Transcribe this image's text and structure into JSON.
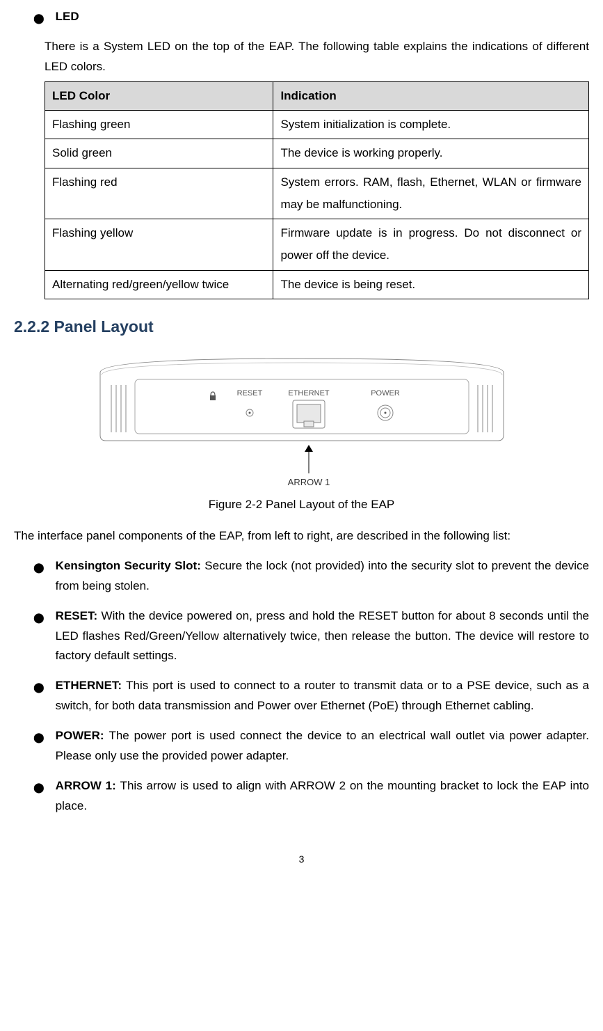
{
  "led": {
    "heading": "LED",
    "intro": "There is a System LED on the top of the EAP. The following table explains the indications of different LED colors.",
    "table": {
      "headers": {
        "col1": "LED Color",
        "col2": "Indication"
      },
      "rows": [
        {
          "color": "Flashing green",
          "indication": "System initialization is complete."
        },
        {
          "color": "Solid green",
          "indication": "The device is working properly."
        },
        {
          "color": "Flashing red",
          "indication": "System errors. RAM, flash, Ethernet, WLAN or firmware may be malfunctioning."
        },
        {
          "color": "Flashing yellow",
          "indication": "Firmware update is in progress. Do not disconnect or power off the device."
        },
        {
          "color": "Alternating red/green/yellow twice",
          "indication": "The device is being reset."
        }
      ]
    }
  },
  "section": {
    "number": "2.2.2",
    "title": "Panel Layout"
  },
  "figure": {
    "labels": {
      "reset": "RESET",
      "ethernet": "ETHERNET",
      "power": "POWER",
      "arrow": "ARROW 1"
    },
    "caption": "Figure 2-2 Panel Layout of the EAP"
  },
  "interface": {
    "intro": "The interface panel components of the EAP, from left to right, are described in the following list:",
    "items": [
      {
        "title": "Kensington Security Slot: ",
        "desc": "Secure the lock (not provided) into the security slot to prevent the device from being stolen."
      },
      {
        "title": "RESET: ",
        "desc": "With the device powered on, press and hold the RESET button for about 8 seconds until the LED flashes Red/Green/Yellow alternatively twice, then release the button. The device will restore to factory default settings."
      },
      {
        "title": "ETHERNET: ",
        "desc": "This port is used to connect to a router to transmit data or to a PSE device, such as a switch, for both data transmission and Power over Ethernet (PoE) through Ethernet cabling."
      },
      {
        "title": "POWER: ",
        "desc": "The power port is used connect the device to an electrical wall outlet via power adapter. Please only use the provided power adapter."
      },
      {
        "title": "ARROW 1: ",
        "desc": "This arrow is used to align with ARROW 2 on the mounting bracket to lock the EAP into place."
      }
    ]
  },
  "pageNumber": "3"
}
